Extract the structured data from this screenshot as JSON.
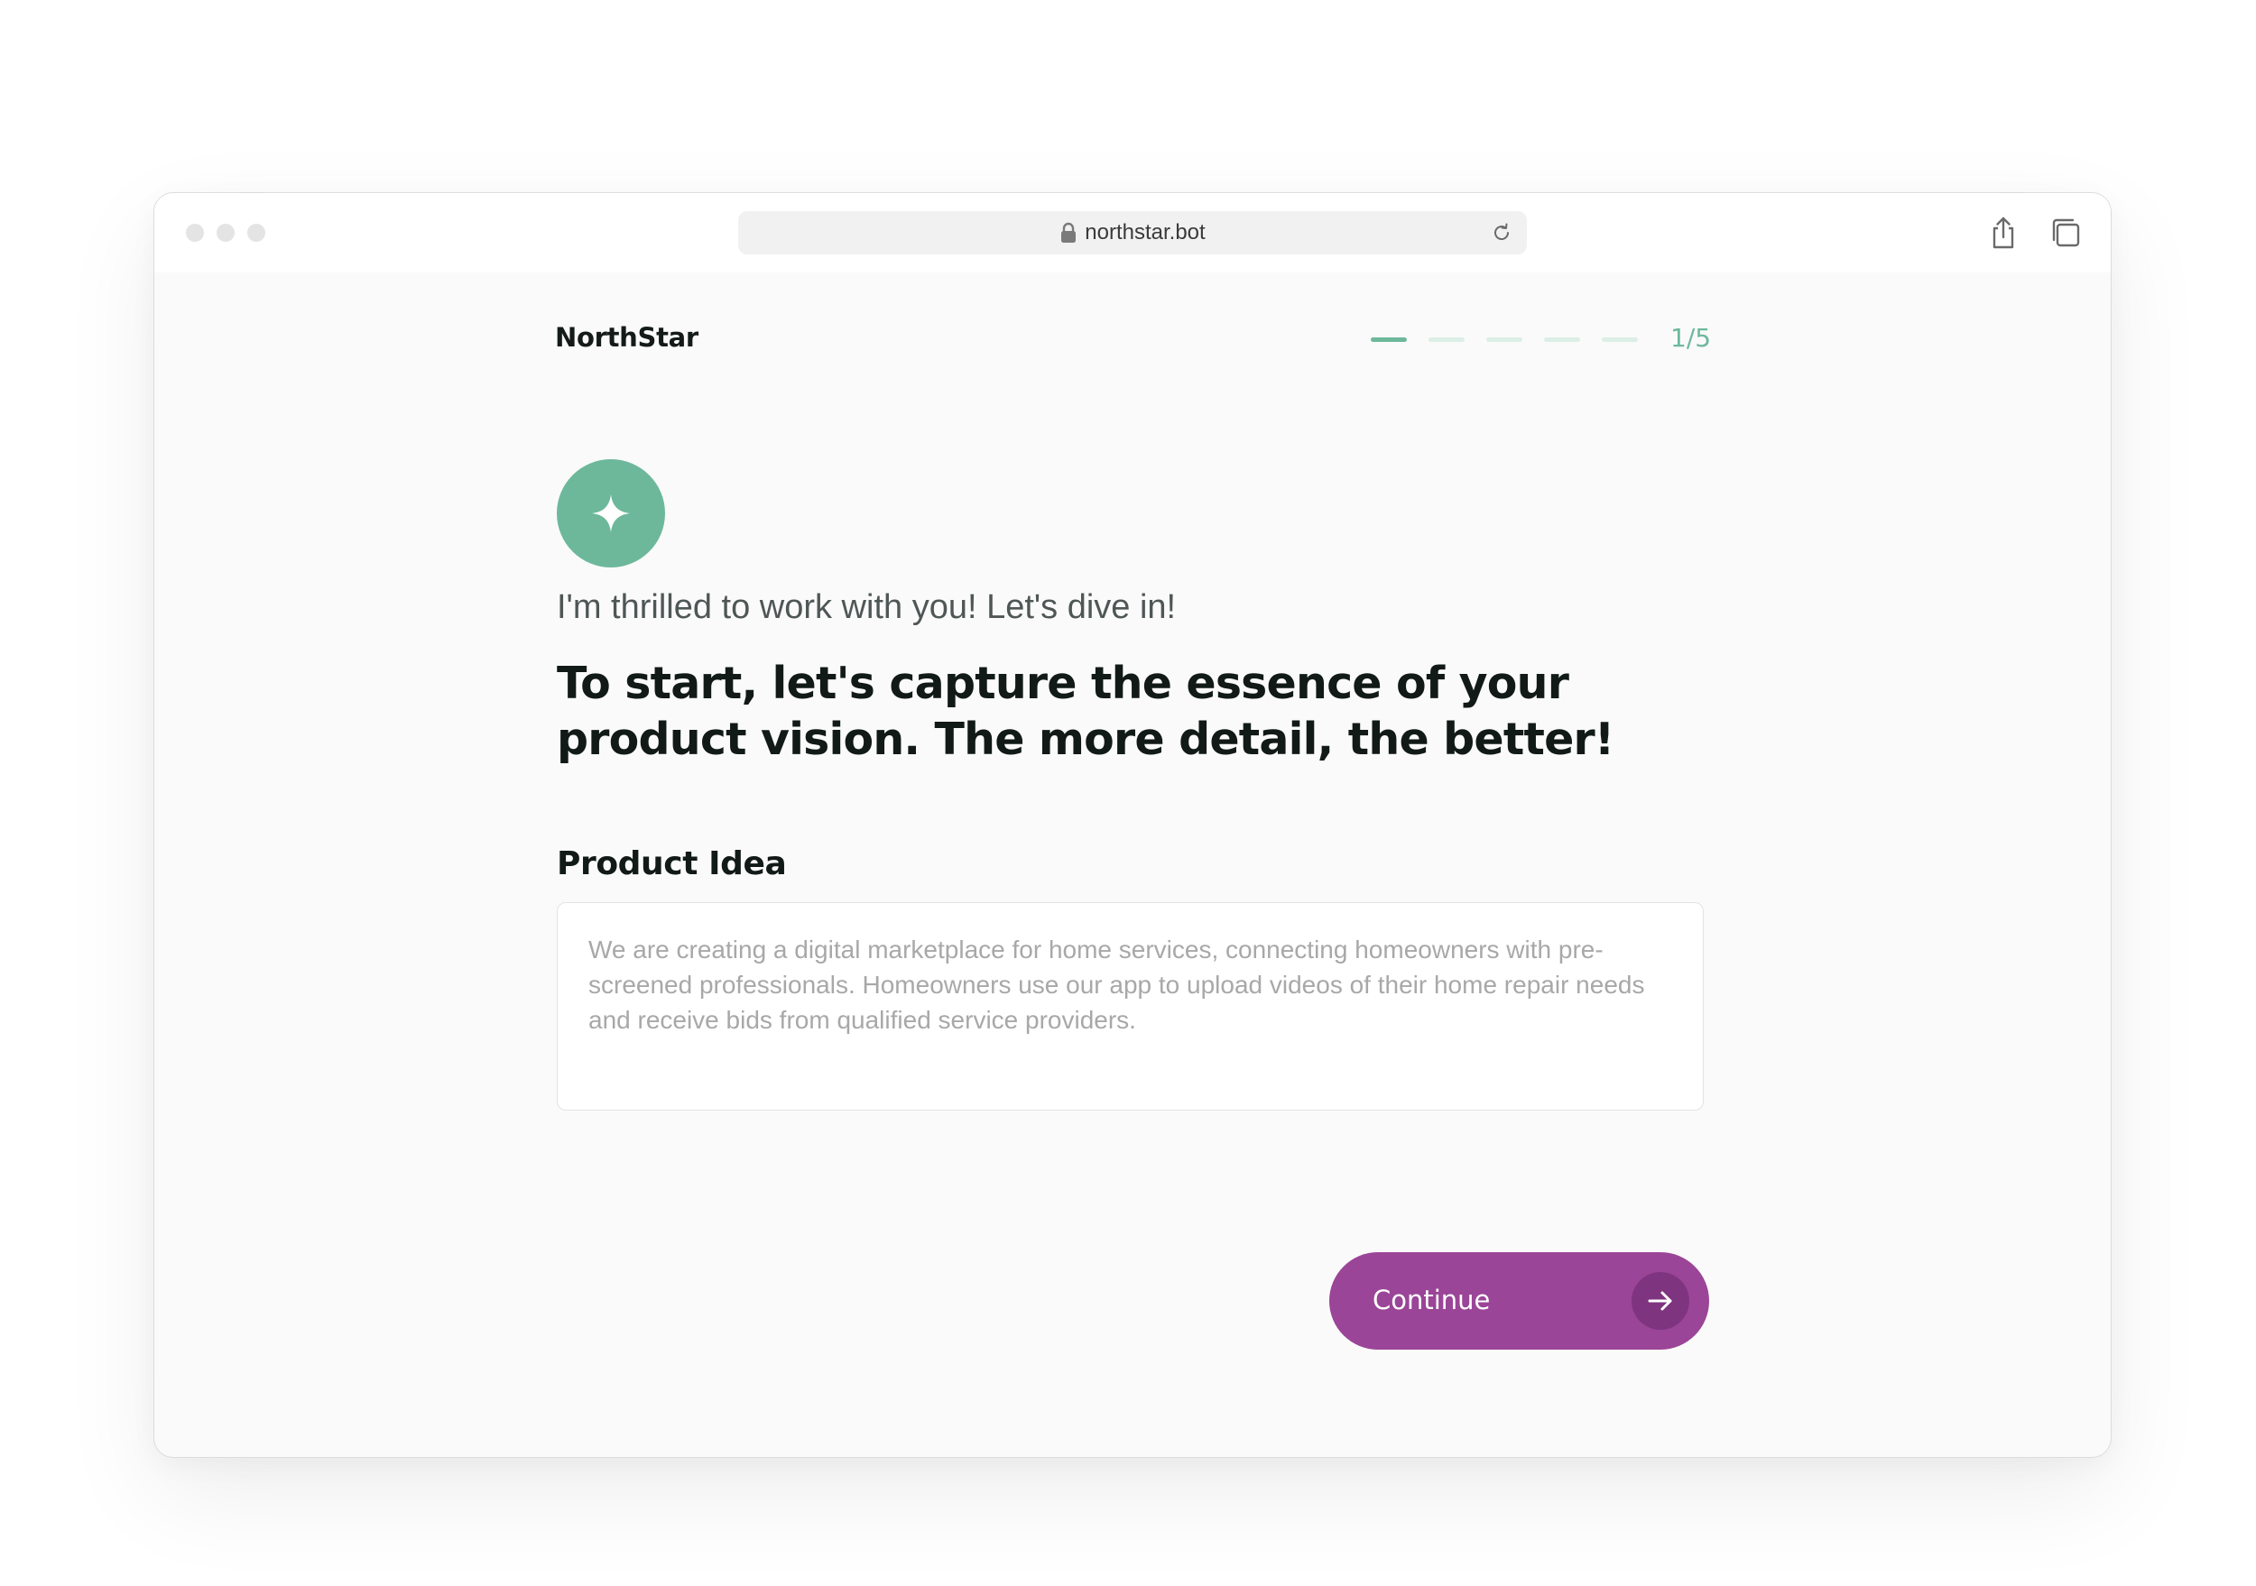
{
  "browser": {
    "url": "northstar.bot"
  },
  "header": {
    "brand": "NorthStar",
    "progress": {
      "current_step": 1,
      "total_steps": 5,
      "label": "1/5"
    }
  },
  "main": {
    "greeting": "I'm thrilled to work with you! Let's dive in!",
    "headline": "To start, let's capture the essence of your product vision. The more detail, the better!",
    "field": {
      "label": "Product Idea",
      "placeholder": "We are creating a digital marketplace for home services, connecting homeowners with pre-screened professionals. Homeowners use our app to upload videos of their home repair needs and receive bids from qualified service providers."
    },
    "continue_label": "Continue"
  },
  "icons": {
    "avatar": "sparkle-icon",
    "continue": "arrow-right-icon",
    "share": "share-icon",
    "tabs": "tabs-icon",
    "lock": "lock-icon",
    "reload": "reload-icon"
  },
  "colors": {
    "accent_green": "#6db89b",
    "step_inactive": "#dcefe7",
    "button_purple": "#9a4597",
    "button_arrow_circle": "#7f3480",
    "heading_text": "#121a18",
    "body_text": "#4f5756",
    "placeholder_text": "#a8a8a8"
  }
}
